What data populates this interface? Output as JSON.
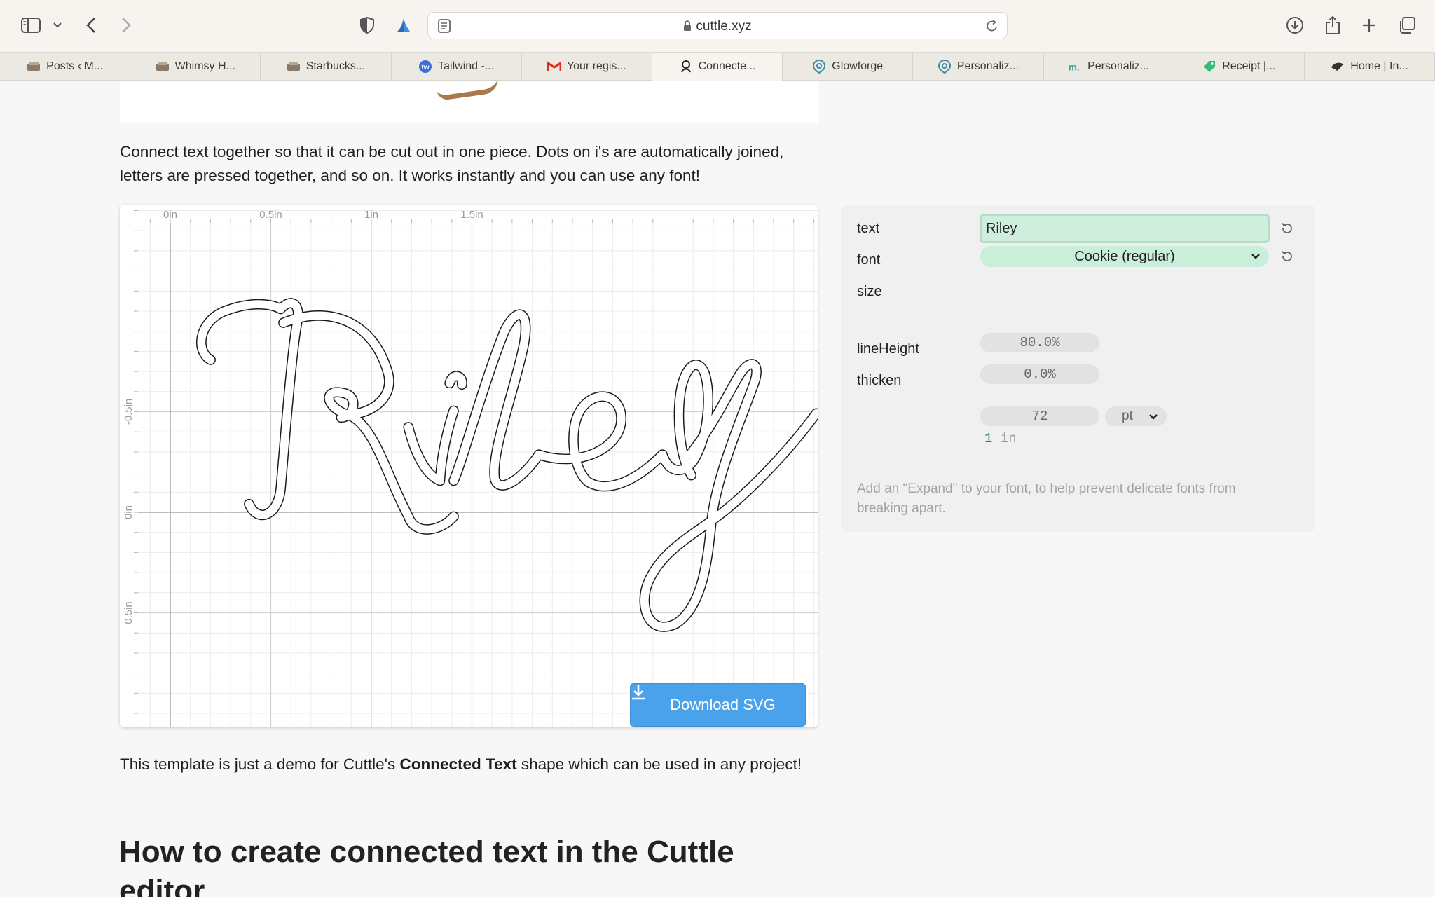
{
  "browser": {
    "url": "cuttle.xyz",
    "tabs": [
      {
        "label": "Posts ‹ M...",
        "icon": "site-favicon"
      },
      {
        "label": "Whimsy H...",
        "icon": "site-favicon"
      },
      {
        "label": "Starbucks...",
        "icon": "site-favicon"
      },
      {
        "label": "Tailwind -...",
        "icon": "tw-favicon"
      },
      {
        "label": "Your regis...",
        "icon": "gmail-favicon"
      },
      {
        "label": "Connecte...",
        "icon": "cuttle-favicon",
        "active": true
      },
      {
        "label": "Glowforge",
        "icon": "glowforge-favicon"
      },
      {
        "label": "Personaliz...",
        "icon": "glowforge-favicon"
      },
      {
        "label": "Personaliz...",
        "icon": "m-favicon"
      },
      {
        "label": "Receipt |...",
        "icon": "tag-favicon"
      },
      {
        "label": "Home | In...",
        "icon": "bird-favicon"
      }
    ]
  },
  "page": {
    "intro": "Connect text together so that it can be cut out in one piece. Dots on i's are automatically joined, letters are pressed together, and so on. It works instantly and you can use any font!",
    "outro_prefix": "This template is just a demo for Cuttle's ",
    "outro_bold": "Connected Text",
    "outro_suffix": " shape which can be used in any project!",
    "heading": "How to create connected text in the Cuttle editor"
  },
  "canvas": {
    "ruler_x": [
      "0in",
      "0.5in",
      "1in",
      "1.5in"
    ],
    "ruler_y": [
      "-0.5in",
      "0in",
      "0.5in"
    ],
    "download_label": "Download SVG"
  },
  "params": {
    "text_label": "text",
    "text_value": "Riley",
    "font_label": "font",
    "font_value": "Cookie (regular)",
    "size_label": "size",
    "size_value": "72",
    "size_unit": "pt",
    "size_conv_value": "1",
    "size_conv_unit": "in",
    "lineheight_label": "lineHeight",
    "lineheight_value": "80.0%",
    "thicken_label": "thicken",
    "thicken_value": "0.0%",
    "hint": "Add an \"Expand\" to your font, to help prevent delicate fonts from breaking apart."
  },
  "colors": {
    "accent_button": "#4aa3ea",
    "field_highlight": "#c9efda"
  }
}
